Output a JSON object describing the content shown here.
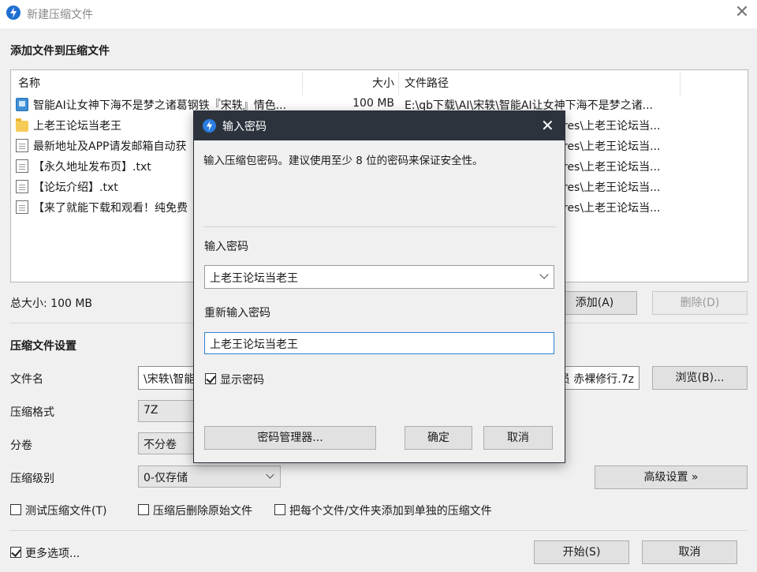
{
  "window": {
    "title": "新建压缩文件",
    "close_glyph": "✕"
  },
  "files_section": {
    "title": "添加文件到压缩文件",
    "columns": {
      "name": "名称",
      "size": "大小",
      "path": "文件路径"
    },
    "rows": [
      {
        "icon": "exe-file-icon",
        "name": "智能AI让女神下海不是梦之诸葛钢铁『宋轶』情色...",
        "size": "100 MB",
        "path": "E:\\qb下载\\AI\\宋轶\\智能AI让女神下海不是梦之诸..."
      },
      {
        "icon": "folder-icon",
        "name": "上老王论坛当老王",
        "size": "",
        "path": "res\\上老王论坛当..."
      },
      {
        "icon": "text-file-icon",
        "name": "最新地址及APP请发邮箱自动获",
        "size": "",
        "path": "res\\上老王论坛当..."
      },
      {
        "icon": "text-file-icon",
        "name": "【永久地址发布页】.txt",
        "size": "",
        "path": "res\\上老王论坛当..."
      },
      {
        "icon": "text-file-icon",
        "name": "【论坛介绍】.txt",
        "size": "",
        "path": "res\\上老王论坛当..."
      },
      {
        "icon": "text-file-icon",
        "name": "【来了就能下载和观看！纯免费",
        "size": "",
        "path": "res\\上老王论坛当..."
      }
    ],
    "total_size": "总大小: 100 MB",
    "add_button": "添加(A)",
    "delete_button": "删除(D)"
  },
  "settings": {
    "title": "压缩文件设置",
    "filename_label": "文件名",
    "filename_value_start": "\\宋轶\\智能",
    "filename_value_end": "员 赤裸修行.7z",
    "browse_button": "浏览(B)...",
    "format_label": "压缩格式",
    "format_value": "7Z",
    "split_label": "分卷",
    "split_value": "不分卷",
    "level_label": "压缩级别",
    "level_value": "0-仅存储",
    "advanced_button": "高级设置 »",
    "test_archive": "测试压缩文件(T)",
    "delete_after": "压缩后删除原始文件",
    "each_separate": "把每个文件/文件夹添加到单独的压缩文件"
  },
  "footer": {
    "more_options": "更多选项...",
    "start_button": "开始(S)",
    "cancel_button": "取消"
  },
  "password_dialog": {
    "title": "输入密码",
    "close_glyph": "✕",
    "description": "输入压缩包密码。建议使用至少 8 位的密码来保证安全性。",
    "password_label": "输入密码",
    "password_value": "上老王论坛当老王",
    "confirm_label": "重新输入密码",
    "confirm_value": "上老王论坛当老王",
    "show_password": "显示密码",
    "manager_button": "密码管理器...",
    "ok_button": "确定",
    "cancel_button": "取消"
  }
}
